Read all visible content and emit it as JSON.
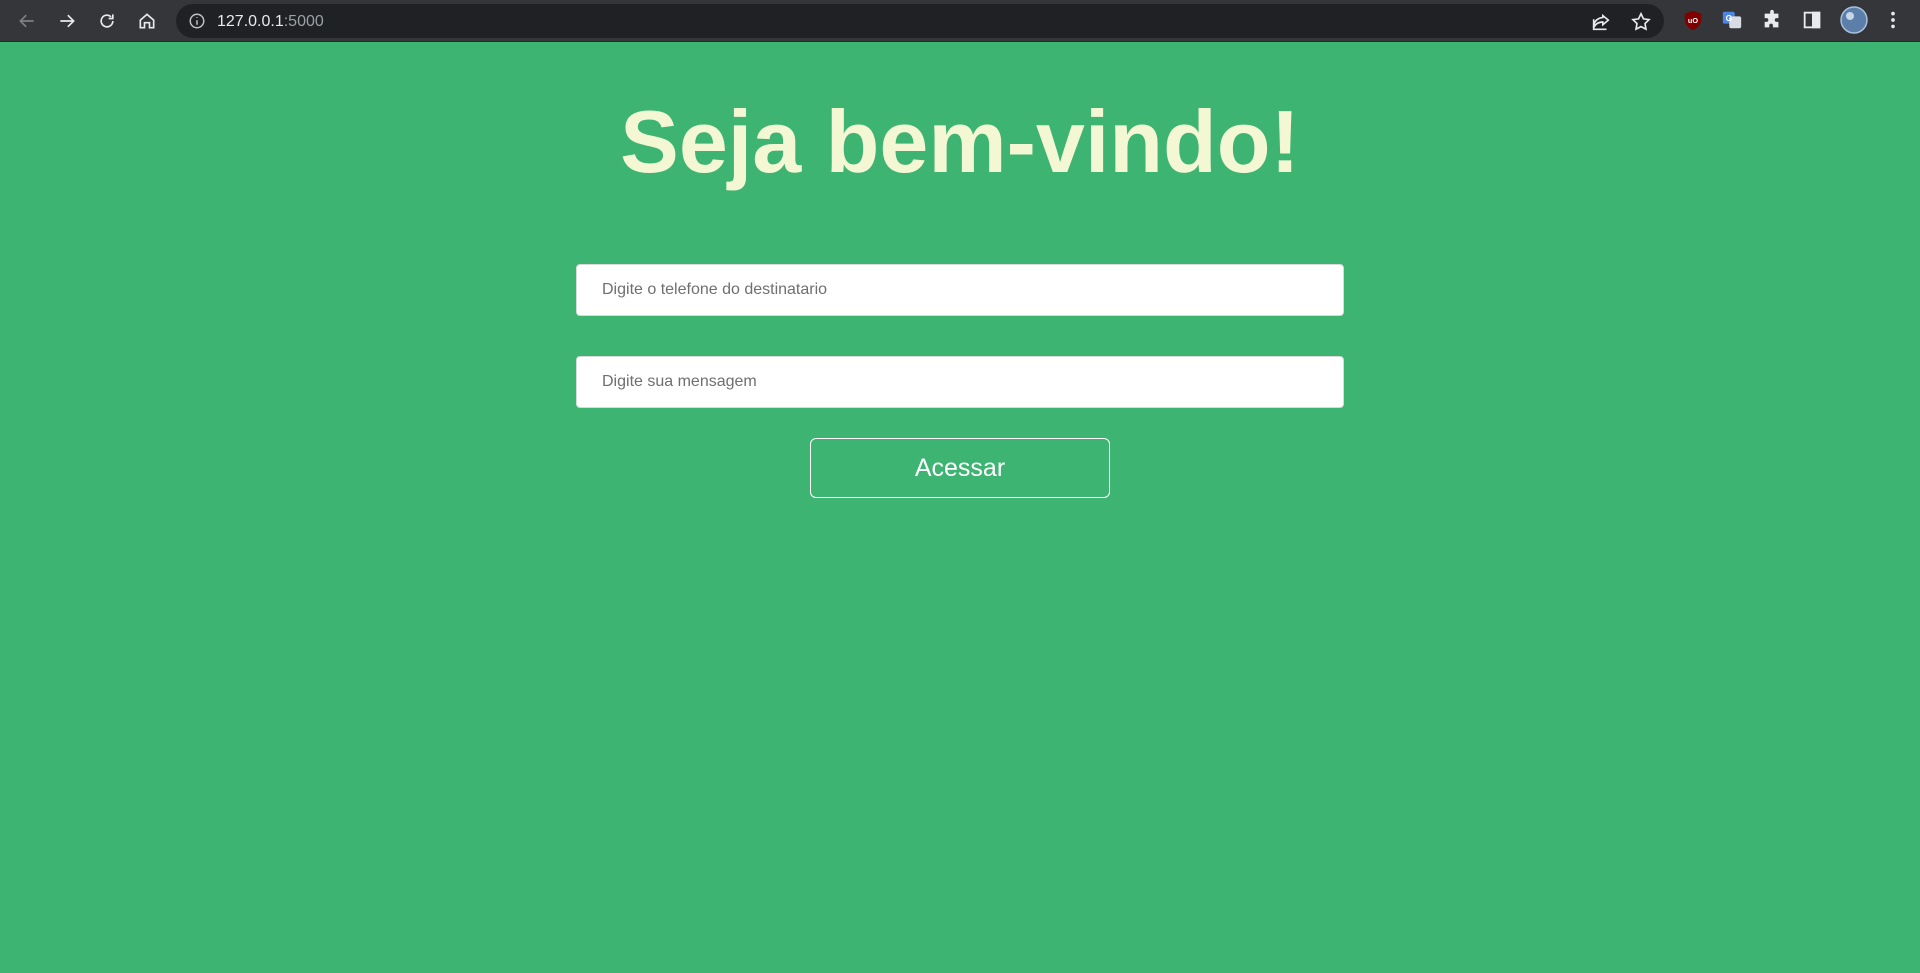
{
  "browser": {
    "url_host": "127.0.0.1",
    "url_port": ":5000",
    "icons": [
      "back-icon",
      "forward-icon",
      "reload-icon",
      "home-icon",
      "site-info-icon",
      "share-icon",
      "bookmark-star-icon",
      "ublock-extension-icon",
      "translate-extension-icon",
      "extensions-puzzle-icon",
      "side-panel-icon",
      "profile-avatar",
      "kebab-menu-icon"
    ]
  },
  "page": {
    "title": "Seja bem-vindo!",
    "phone_placeholder": "Digite o telefone do destinatario",
    "message_placeholder": "Digite sua mensagem",
    "submit_label": "Acessar"
  },
  "colors": {
    "background": "#3db472",
    "title": "#f4f7d4",
    "toolbar": "#35363a",
    "omnibox": "#202124"
  }
}
